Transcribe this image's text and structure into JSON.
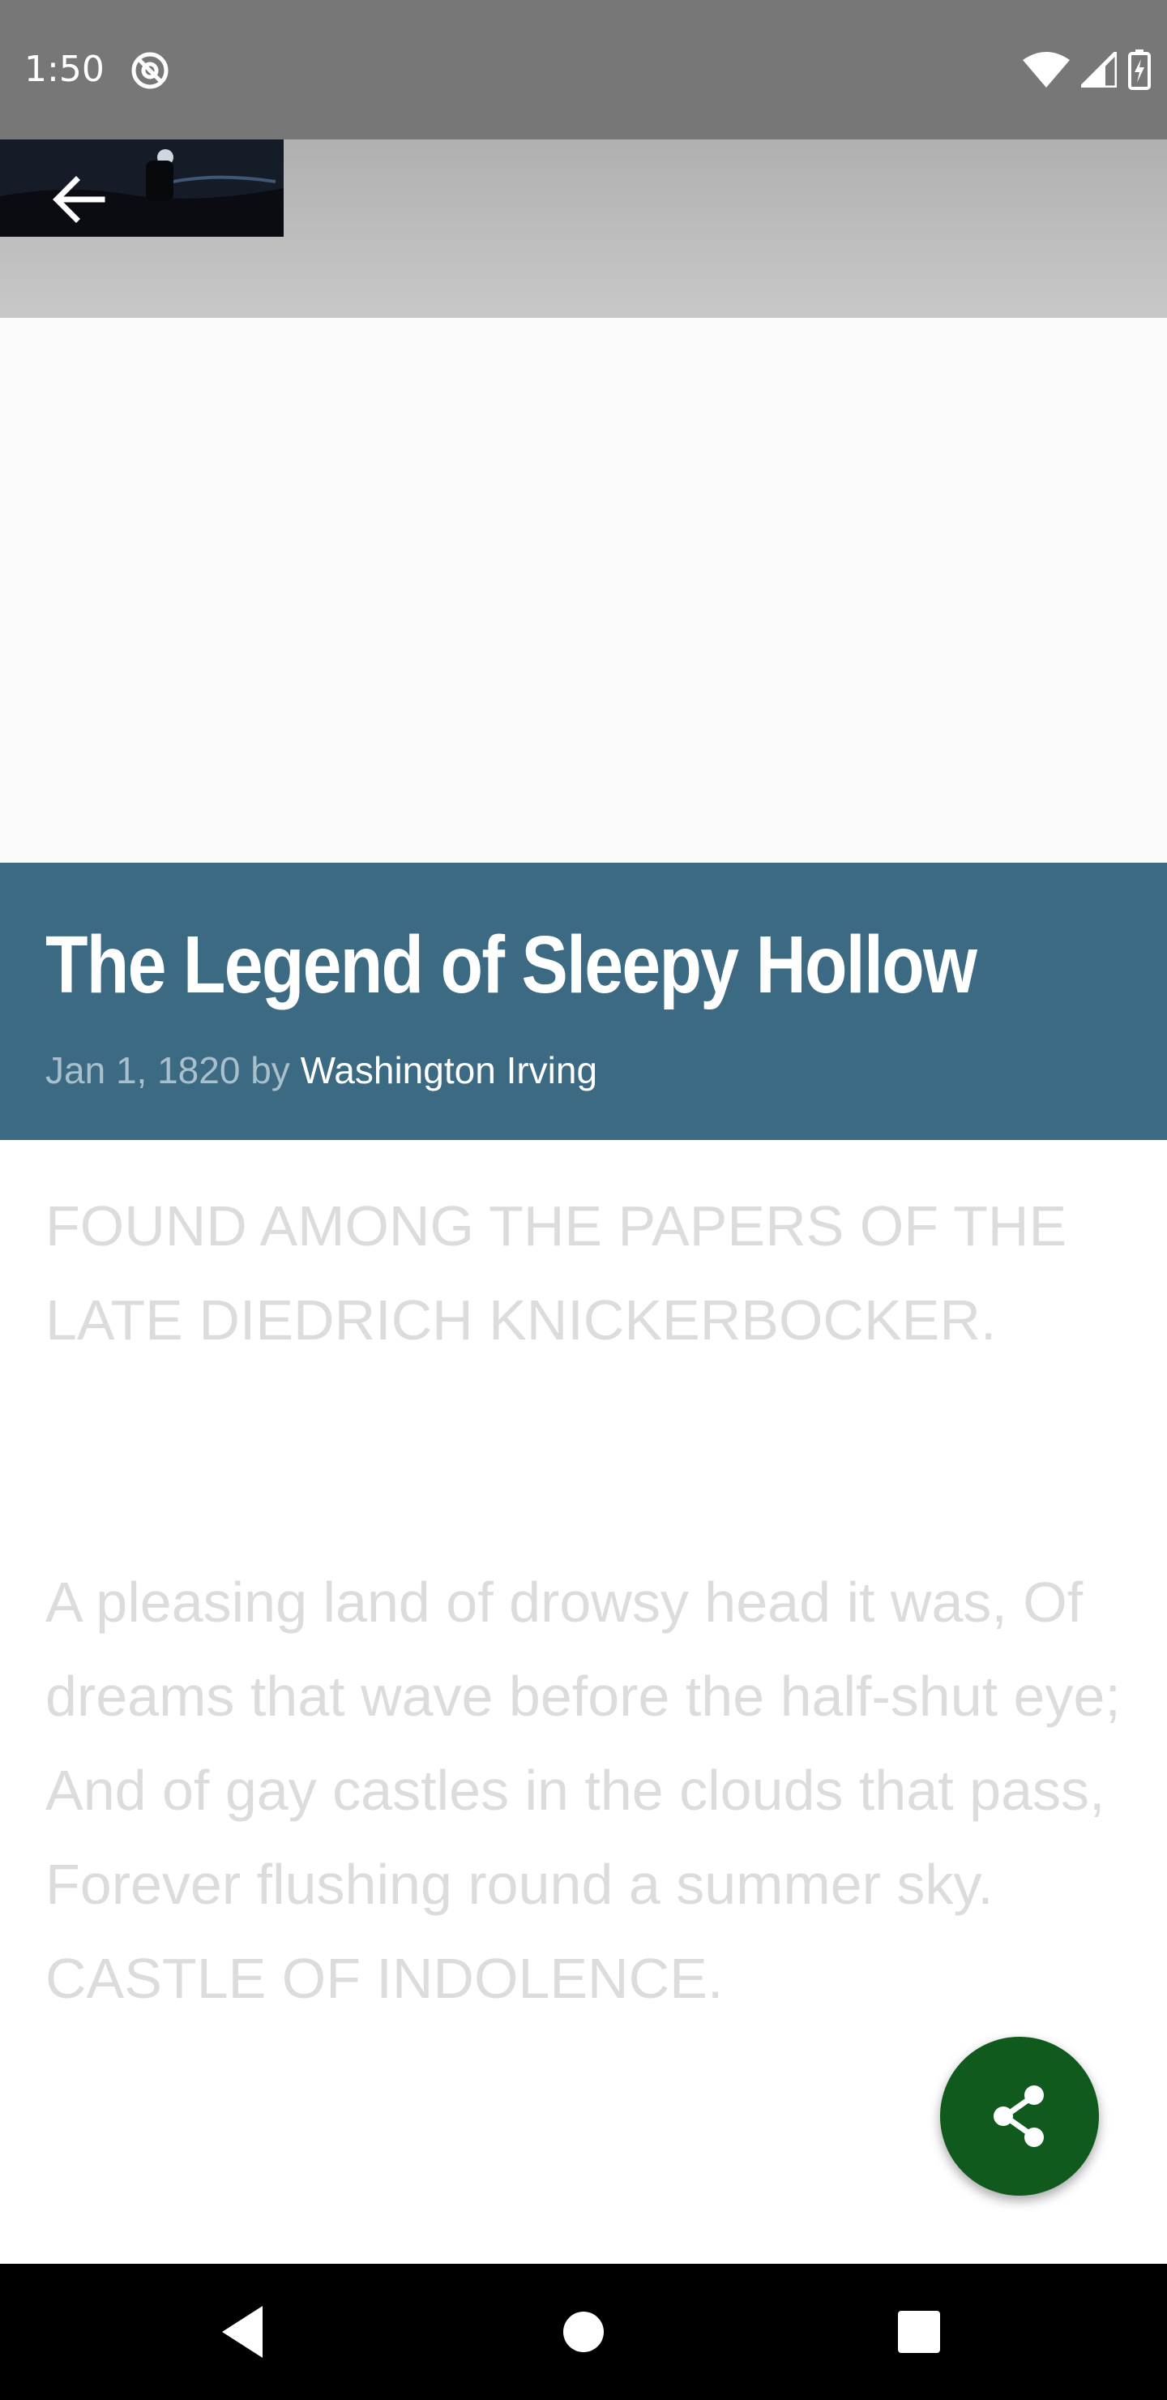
{
  "status_bar": {
    "time": "1:50",
    "icons": [
      "at-sign-icon",
      "wifi-icon",
      "signal-icon",
      "battery-charging-icon"
    ]
  },
  "toolbar": {
    "back_icon": "arrow-left-icon"
  },
  "article": {
    "title": "The Legend of Sleepy Hollow",
    "date_by": "Jan 1, 1820 by ",
    "author": "Washington Irving",
    "paragraphs": [
      "FOUND AMONG THE PAPERS OF THE LATE DIEDRICH KNICKERBOCKER.",
      "A pleasing land of drowsy head it was, Of dreams that wave before the half-shut eye; And of gay castles in the clouds that pass, Forever flushing round a summer sky. CASTLE OF INDOLENCE."
    ]
  },
  "fab": {
    "icon": "share-icon"
  },
  "nav_bar": {
    "icons": [
      "back-triangle-icon",
      "home-circle-icon",
      "recents-square-icon"
    ]
  },
  "colors": {
    "banner": "#3b6a82",
    "fab": "#0f5a1c",
    "status_bar": "#777777"
  }
}
